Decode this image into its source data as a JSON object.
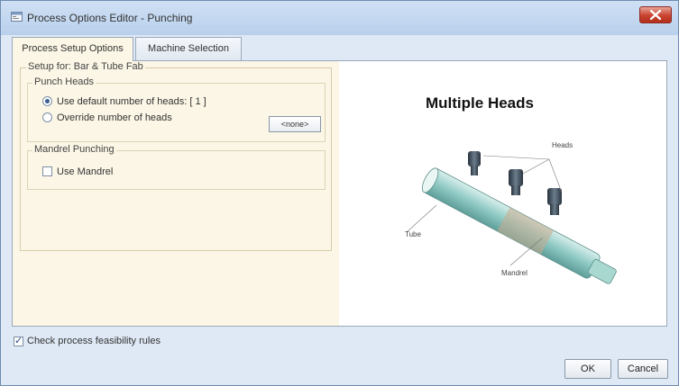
{
  "window": {
    "title": "Process Options Editor - Punching"
  },
  "tabs": [
    {
      "label": "Process Setup Options",
      "active": true
    },
    {
      "label": "Machine Selection",
      "active": false
    }
  ],
  "setup": {
    "label": "Setup for: Bar & Tube Fab",
    "punch_heads": {
      "label": "Punch Heads",
      "default_option": {
        "label": "Use default number of heads:  [ 1 ]",
        "checked": true
      },
      "override_option": {
        "label": "Override number of heads",
        "checked": false
      },
      "override_value": "<none>"
    },
    "mandrel": {
      "label": "Mandrel Punching",
      "use_mandrel": {
        "label": "Use Mandrel",
        "checked": false
      }
    }
  },
  "diagram": {
    "title": "Multiple Heads",
    "callouts": {
      "heads": "Heads",
      "tube": "Tube",
      "mandrel": "Mandrel"
    }
  },
  "feasibility": {
    "label": "Check process feasibility rules",
    "checked": true
  },
  "buttons": {
    "ok": "OK",
    "cancel": "Cancel"
  },
  "colors": {
    "panel_bg": "#fbf6e6",
    "window_bg": "#dfe9f5",
    "close_red": "#c9432f",
    "tube_teal": "#8fc9c4",
    "head_dark": "#3b4a5a"
  },
  "icons": {
    "title": "window-app-icon",
    "close": "close-icon"
  }
}
